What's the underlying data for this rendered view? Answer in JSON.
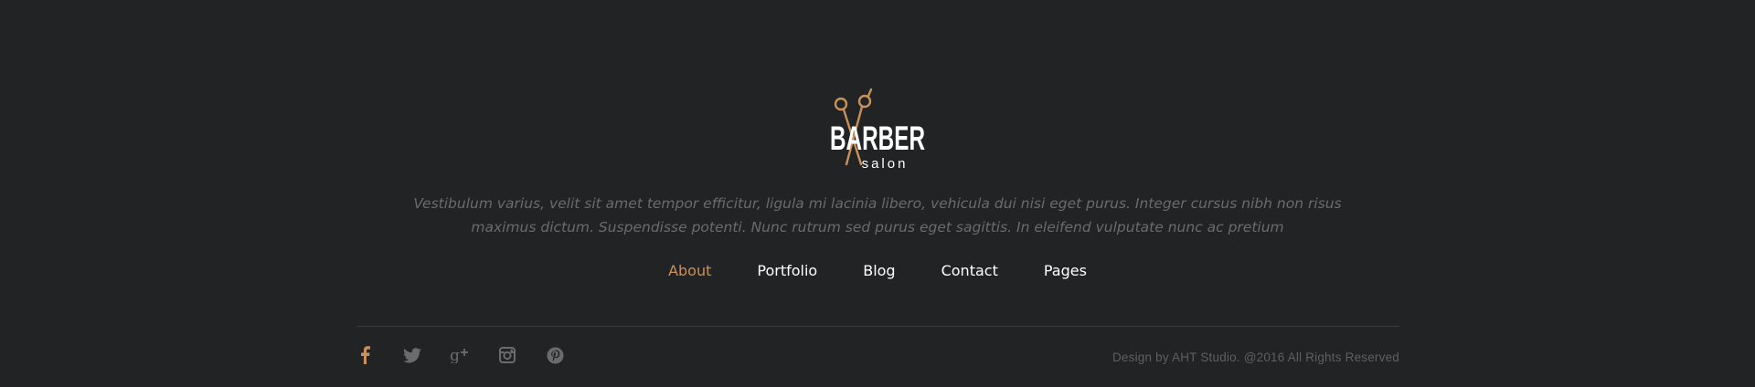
{
  "brand": {
    "logo_word": "BARBER",
    "logo_sub": "salon",
    "accent_color": "#c8915a",
    "background_color": "#222324"
  },
  "footer": {
    "description": "Vestibulum varius, velit sit amet tempor efficitur, ligula mi lacinia libero, vehicula dui nisi eget purus. Integer cursus nibh non risus maximus dictum. Suspendisse potenti. Nunc rutrum sed purus eget sagittis. In eleifend vulputate nunc ac pretium",
    "nav": [
      {
        "label": "About",
        "active": true
      },
      {
        "label": "Portfolio",
        "active": false
      },
      {
        "label": "Blog",
        "active": false
      },
      {
        "label": "Contact",
        "active": false
      },
      {
        "label": "Pages",
        "active": false
      }
    ],
    "social": [
      {
        "icon": "facebook-icon"
      },
      {
        "icon": "twitter-icon"
      },
      {
        "icon": "google-plus-icon"
      },
      {
        "icon": "instagram-icon"
      },
      {
        "icon": "pinterest-icon"
      }
    ],
    "copyright": "Design by AHT Studio. @2016 All Rights Reserved"
  }
}
